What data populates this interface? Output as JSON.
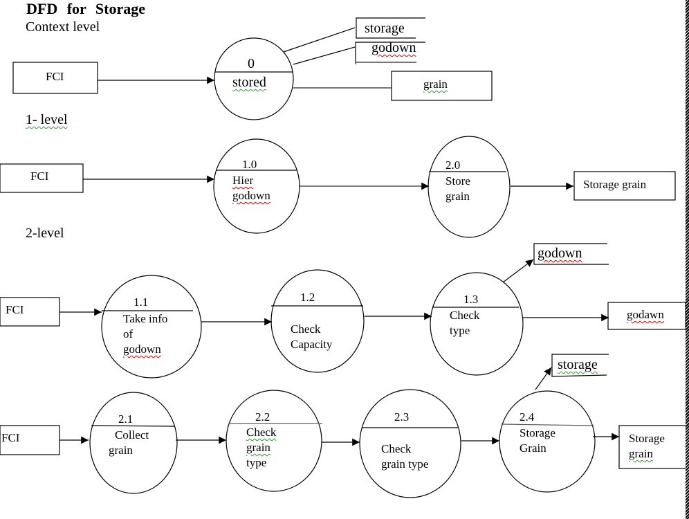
{
  "title": "DFD for Storage",
  "sections": {
    "context": "Context level",
    "level1": "1- level",
    "level2": "2-level"
  },
  "context": {
    "source": "FCI",
    "process": {
      "id": "0",
      "name": "stored"
    },
    "stores": [
      "storage",
      "godown"
    ],
    "sink": "grain"
  },
  "level1": {
    "source": "FCI",
    "processes": [
      {
        "id": "1.0",
        "name_lines": [
          "Hier",
          "godown"
        ]
      },
      {
        "id": "2.0",
        "name_lines": [
          "Store",
          "grain"
        ]
      }
    ],
    "sink": "Storage grain"
  },
  "level2_row1": {
    "source": "FCI",
    "processes": [
      {
        "id": "1.1",
        "name_lines": [
          "Take info",
          "of",
          "godown"
        ]
      },
      {
        "id": "1.2",
        "name_lines": [
          "Check",
          "Capacity"
        ]
      },
      {
        "id": "1.3",
        "name_lines": [
          "Check",
          "type"
        ]
      }
    ],
    "store": "godown",
    "sink": "godawn"
  },
  "level2_row2": {
    "source": "FCI",
    "processes": [
      {
        "id": "2.1",
        "name_lines": [
          "Collect",
          "grain"
        ]
      },
      {
        "id": "2.2",
        "name_lines": [
          "Check",
          "grain",
          "type"
        ]
      },
      {
        "id": "2.3",
        "name_lines": [
          "Check",
          "grain type"
        ]
      },
      {
        "id": "2.4",
        "name_lines": [
          "Storage",
          "Grain"
        ]
      }
    ],
    "store": "storage",
    "sink_lines": [
      "Storage",
      "grain"
    ]
  }
}
